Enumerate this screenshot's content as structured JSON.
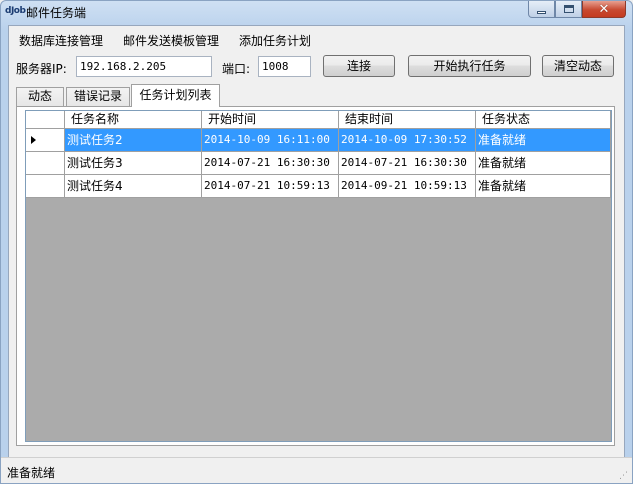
{
  "window": {
    "icon_text": "dJob",
    "title": "邮件任务端",
    "close_glyph": "✕"
  },
  "menu": {
    "items": [
      "数据库连接管理",
      "邮件发送模板管理",
      "添加任务计划"
    ]
  },
  "connection": {
    "server_label": "服务器IP:",
    "server_value": "192.168.2.205",
    "port_label": "端口:",
    "port_value": "1008",
    "connect_button": "连接",
    "start_button": "开始执行任务",
    "clear_button": "清空动态"
  },
  "tabs": [
    {
      "label": "动态",
      "active": false
    },
    {
      "label": "错误记录",
      "active": false
    },
    {
      "label": "任务计划列表",
      "active": true
    }
  ],
  "grid": {
    "columns": [
      "任务名称",
      "开始时间",
      "结束时间",
      "任务状态"
    ],
    "rows": [
      {
        "name": "测试任务2",
        "start": "2014-10-09 16:11:00",
        "end": "2014-10-09 17:30:52",
        "status": "准备就绪",
        "selected": true
      },
      {
        "name": "测试任务3",
        "start": "2014-07-21 16:30:30",
        "end": "2014-07-21 16:30:30",
        "status": "准备就绪",
        "selected": false
      },
      {
        "name": "测试任务4",
        "start": "2014-07-21 10:59:13",
        "end": "2014-09-21 10:59:13",
        "status": "准备就绪",
        "selected": false
      }
    ]
  },
  "status_bar": {
    "text": "准备就绪"
  },
  "colors": {
    "selection": "#3399ff",
    "grid_background": "#ababab",
    "title_bar": "#b9d1ec"
  }
}
